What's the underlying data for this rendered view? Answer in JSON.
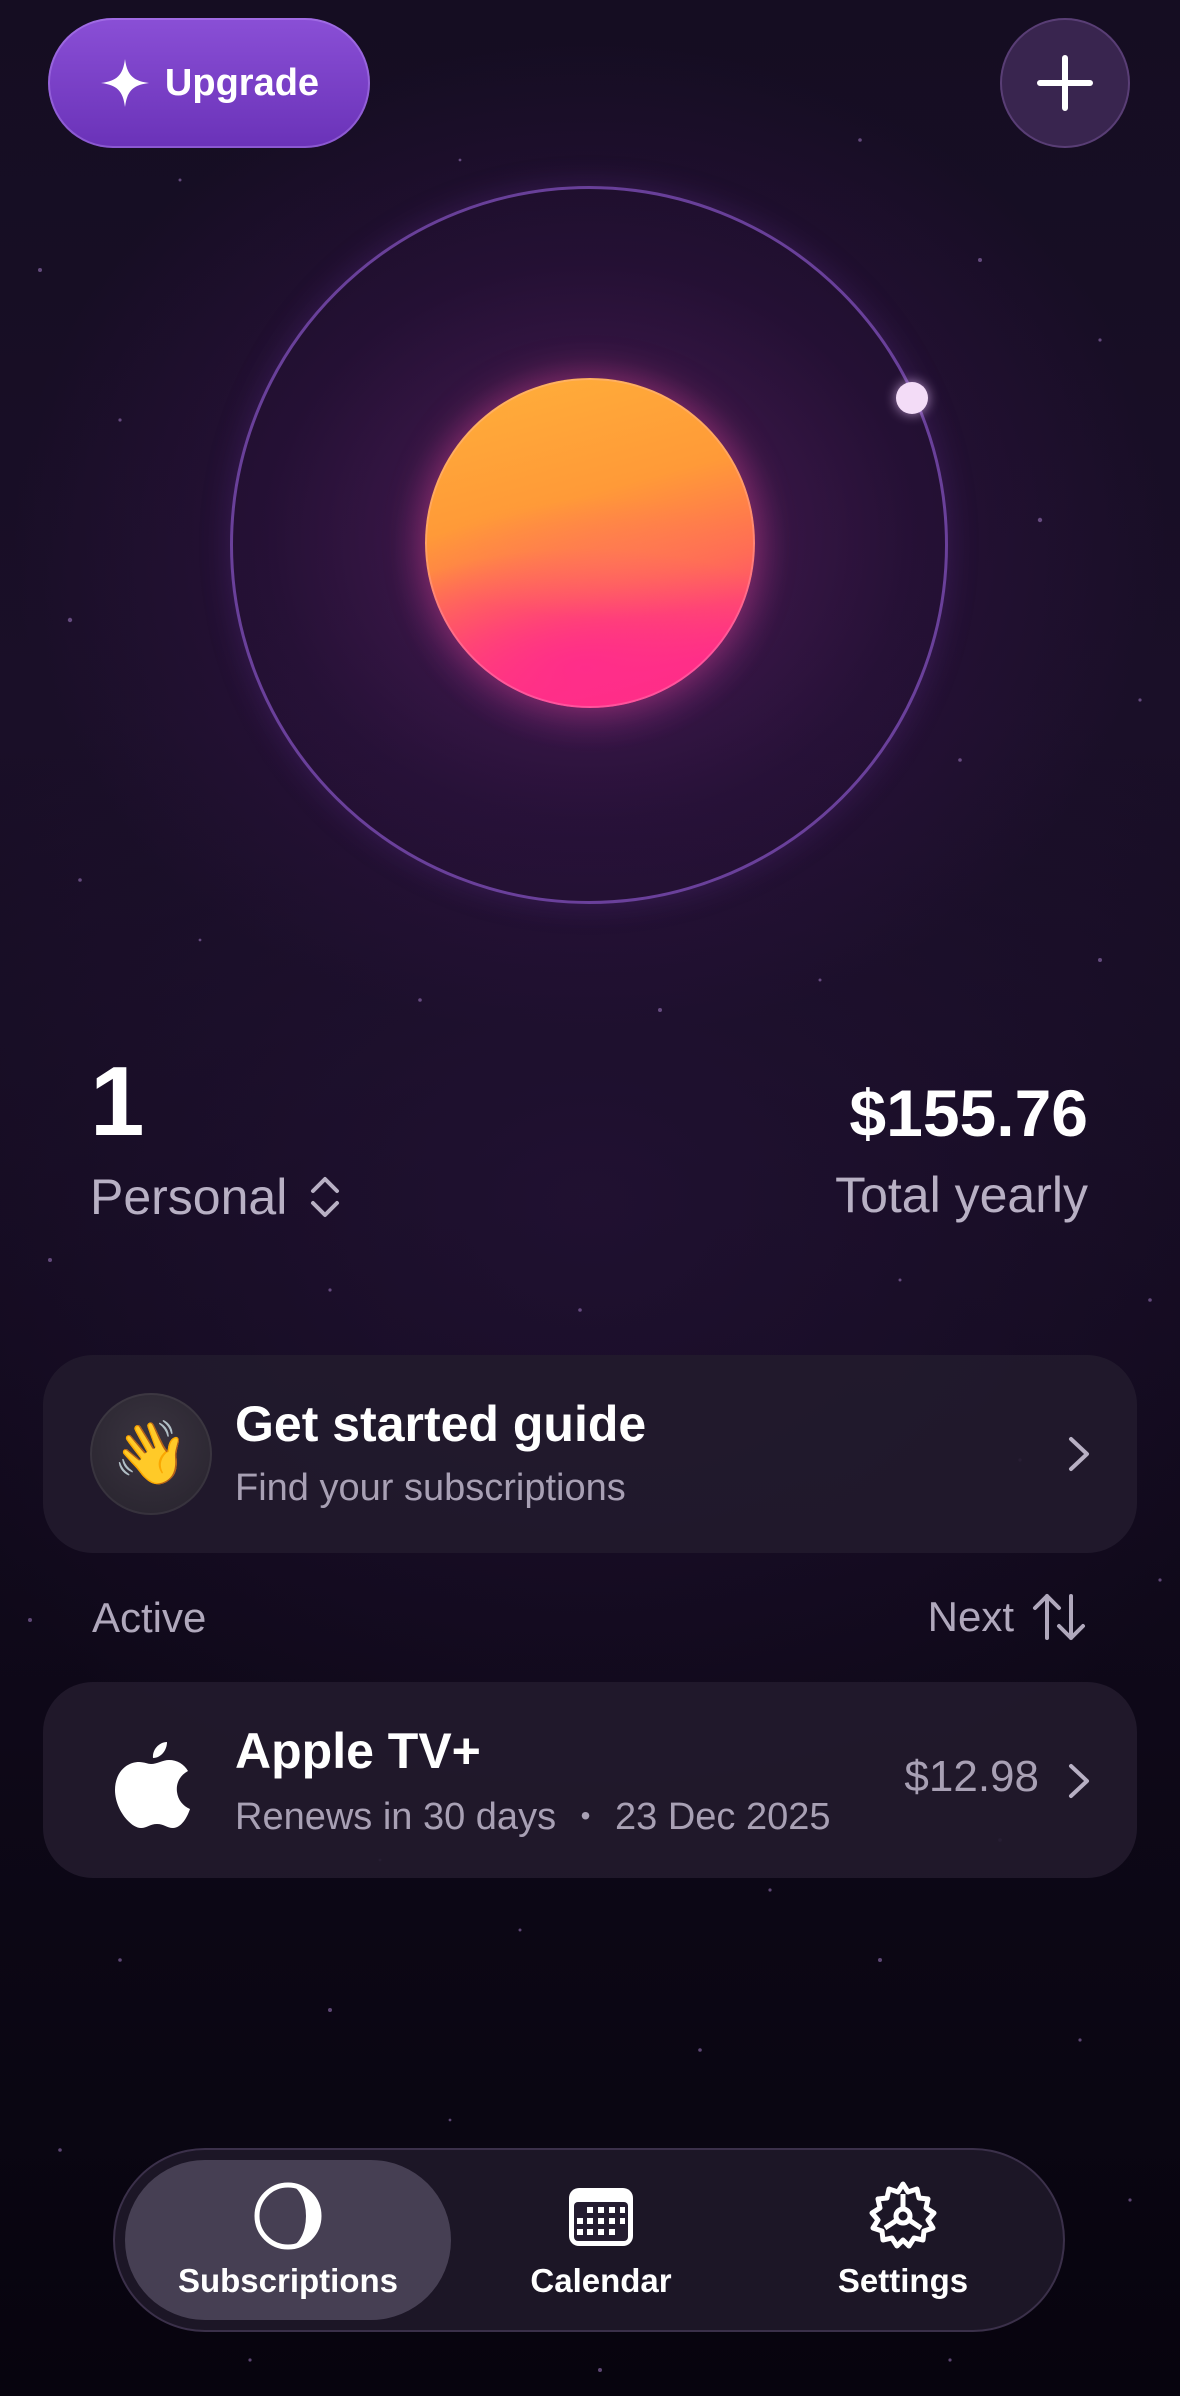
{
  "header": {
    "upgrade_label": "Upgrade",
    "upgrade_icon": "sparkle-icon",
    "add_icon": "plus-icon"
  },
  "summary": {
    "count": "1",
    "profile": "Personal",
    "total_value": "$155.76",
    "total_label": "Total yearly"
  },
  "guide_card": {
    "emoji": "👋",
    "title": "Get started guide",
    "subtitle": "Find your subscriptions"
  },
  "list_header": {
    "section_label": "Active",
    "sort_label": "Next"
  },
  "subscriptions": [
    {
      "icon": "apple-icon",
      "name": "Apple TV+",
      "renewal": "Renews in 30 days",
      "separator": "•",
      "date": "23 Dec 2025",
      "price": "$12.98"
    }
  ],
  "tabbar": {
    "tabs": [
      {
        "label": "Subscriptions",
        "icon": "subscriptions-icon",
        "active": true
      },
      {
        "label": "Calendar",
        "icon": "calendar-icon",
        "active": false
      },
      {
        "label": "Settings",
        "icon": "gear-icon",
        "active": false
      }
    ]
  },
  "colors": {
    "background": "#110a1c",
    "upgrade_button": "#7a40c8",
    "planet_top": "#ffa73a",
    "planet_bottom": "#ff2f86",
    "card_background": "#221a2c",
    "secondary_text": "#b8b0c4"
  }
}
